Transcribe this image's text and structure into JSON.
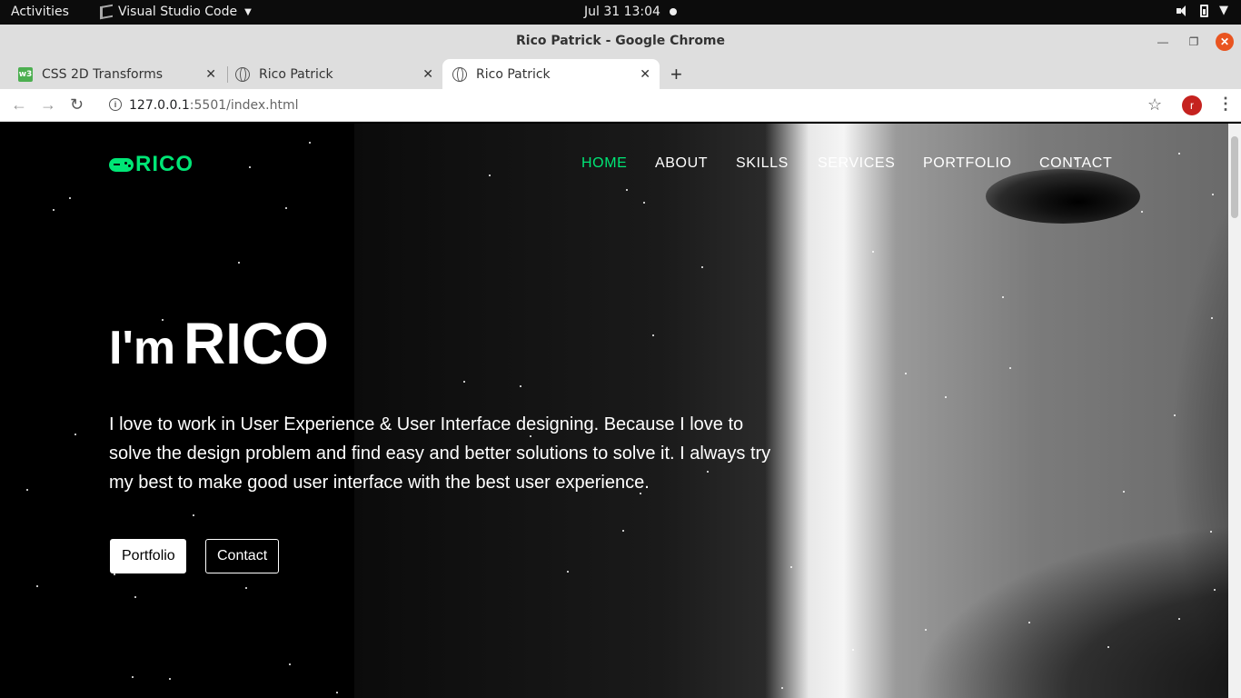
{
  "system_bar": {
    "activities": "Activities",
    "app_name": "Visual Studio Code",
    "clock": "Jul 31  13:04"
  },
  "window": {
    "title": "Rico Patrick - Google Chrome"
  },
  "tabs": [
    {
      "title": "CSS 2D Transforms",
      "active": false
    },
    {
      "title": "Rico Patrick",
      "active": false
    },
    {
      "title": "Rico Patrick",
      "active": true
    }
  ],
  "address_bar": {
    "host": "127.0.0.1",
    "path": ":5501/index.html"
  },
  "profile_initial": "r",
  "site": {
    "logo": "RICO",
    "nav": [
      "HOME",
      "ABOUT",
      "SKILLS",
      "SERVICES",
      "PORTFOLIO",
      "CONTACT"
    ],
    "hero": {
      "greeting": "I'm",
      "name": "RICO",
      "description": "I love to work in User Experience & User Interface designing. Because I love to solve the design problem and find easy and better solutions to solve it. I always try my best to make good user interface with the best user experience.",
      "primary_button": "Portfolio",
      "secondary_button": "Contact"
    },
    "accent_color": "#00e676"
  }
}
